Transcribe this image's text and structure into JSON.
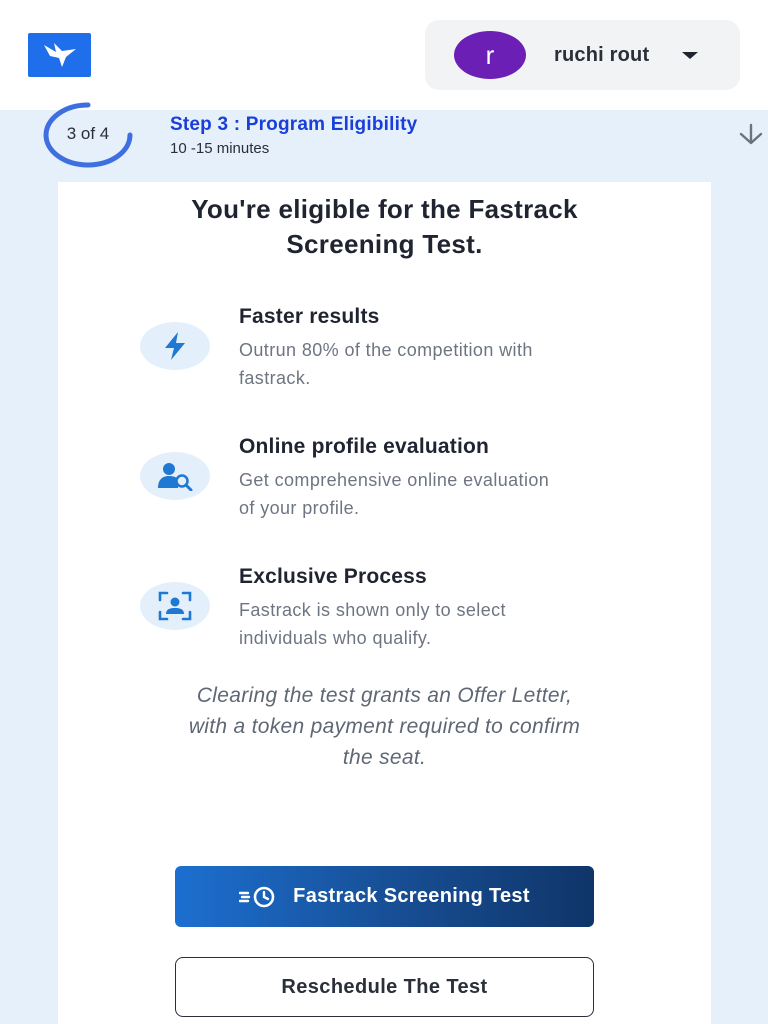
{
  "header": {
    "logo_icon": "bird-logo-icon",
    "user": {
      "avatar_initial": "r",
      "name": "ruchi rout",
      "menu_icon": "caret-down-icon"
    }
  },
  "step": {
    "count": "3 of 4",
    "progress_fraction": 0.75,
    "title": "Step 3 : Program Eligibility",
    "duration": "10 -15 minutes",
    "toggle_icon": "arrow-down-icon"
  },
  "card": {
    "title_line1": "You're eligible for the Fastrack",
    "title_line2": "Screening Test.",
    "features": [
      {
        "icon": "lightning-icon",
        "title": "Faster results",
        "desc_line1": "Outrun 80% of the competition with",
        "desc_line2": "fastrack."
      },
      {
        "icon": "user-search-icon",
        "title": "Online profile evaluation",
        "desc_line1": "Get comprehensive online evaluation",
        "desc_line2": "of your profile."
      },
      {
        "icon": "face-scan-icon",
        "title": "Exclusive Process",
        "desc_line1": "Fastrack is shown only to select",
        "desc_line2": "individuals who qualify."
      }
    ],
    "note_line1": "Clearing the test grants an Offer Letter,",
    "note_line2": "with a token payment required to confirm",
    "note_line3": "the seat.",
    "primary_button": {
      "label": "Fastrack Screening Test",
      "icon": "fast-clock-icon"
    },
    "secondary_button": {
      "label": "Reschedule The Test"
    }
  },
  "colors": {
    "brand_blue": "#1f6fec",
    "step_title": "#1a3fd8",
    "avatar_purple": "#6b1fb5",
    "page_background": "#e6f0fa",
    "primary_button_start": "#1c6fd0",
    "primary_button_end": "#0f3569"
  }
}
